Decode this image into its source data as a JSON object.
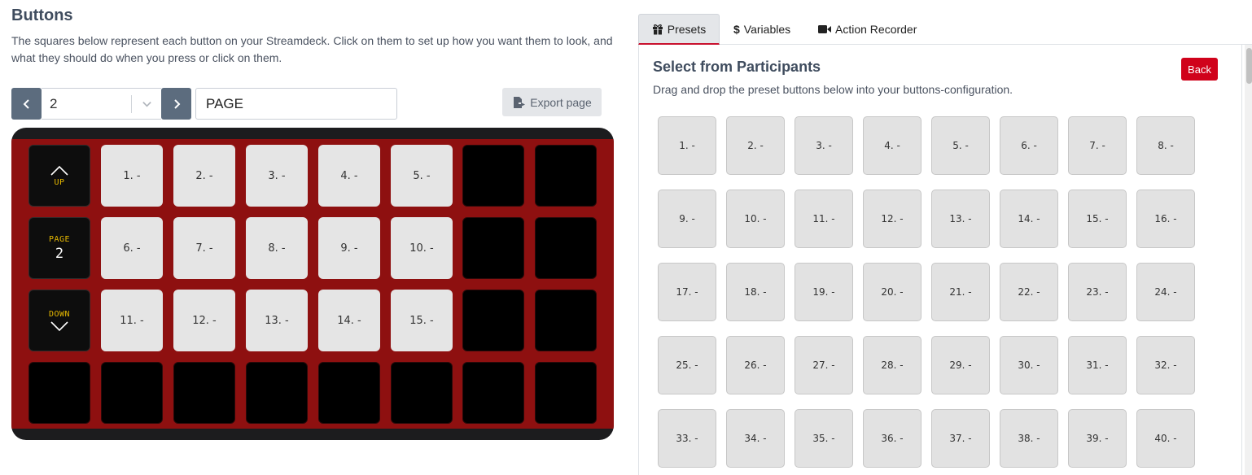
{
  "left": {
    "title": "Buttons",
    "description": "The squares below represent each button on your Streamdeck. Click on them to set up how you want them to look, and what they should do when you press or click on them.",
    "page_select_value": "2",
    "page_name_value": "PAGE",
    "export_label": "Export page"
  },
  "deck": {
    "up_label": "UP",
    "page_label": "PAGE",
    "page_number": "2",
    "down_label": "DOWN",
    "keys": [
      "1. -",
      "2. -",
      "3. -",
      "4. -",
      "5. -",
      "6. -",
      "7. -",
      "8. -",
      "9. -",
      "10. -",
      "11. -",
      "12. -",
      "13. -",
      "14. -",
      "15. -"
    ]
  },
  "right": {
    "tabs": {
      "presets": "Presets",
      "variables": "Variables",
      "recorder": "Action Recorder"
    },
    "panel_title": "Select from Participants",
    "panel_desc": "Drag and drop the preset buttons below into your buttons-configuration.",
    "back_label": "Back",
    "presets": [
      "1. -",
      "2. -",
      "3. -",
      "4. -",
      "5. -",
      "6. -",
      "7. -",
      "8. -",
      "9. -",
      "10. -",
      "11. -",
      "12. -",
      "13. -",
      "14. -",
      "15. -",
      "16. -",
      "17. -",
      "18. -",
      "19. -",
      "20. -",
      "21. -",
      "22. -",
      "23. -",
      "24. -",
      "25. -",
      "26. -",
      "27. -",
      "28. -",
      "29. -",
      "30. -",
      "31. -",
      "32. -",
      "33. -",
      "34. -",
      "35. -",
      "36. -",
      "37. -",
      "38. -",
      "39. -",
      "40. -"
    ]
  },
  "colors": {
    "deck_red": "#8e1010",
    "nav_blue": "#5c6c7e",
    "back_red": "#d0021b",
    "accent_yellow": "#e6b800"
  }
}
